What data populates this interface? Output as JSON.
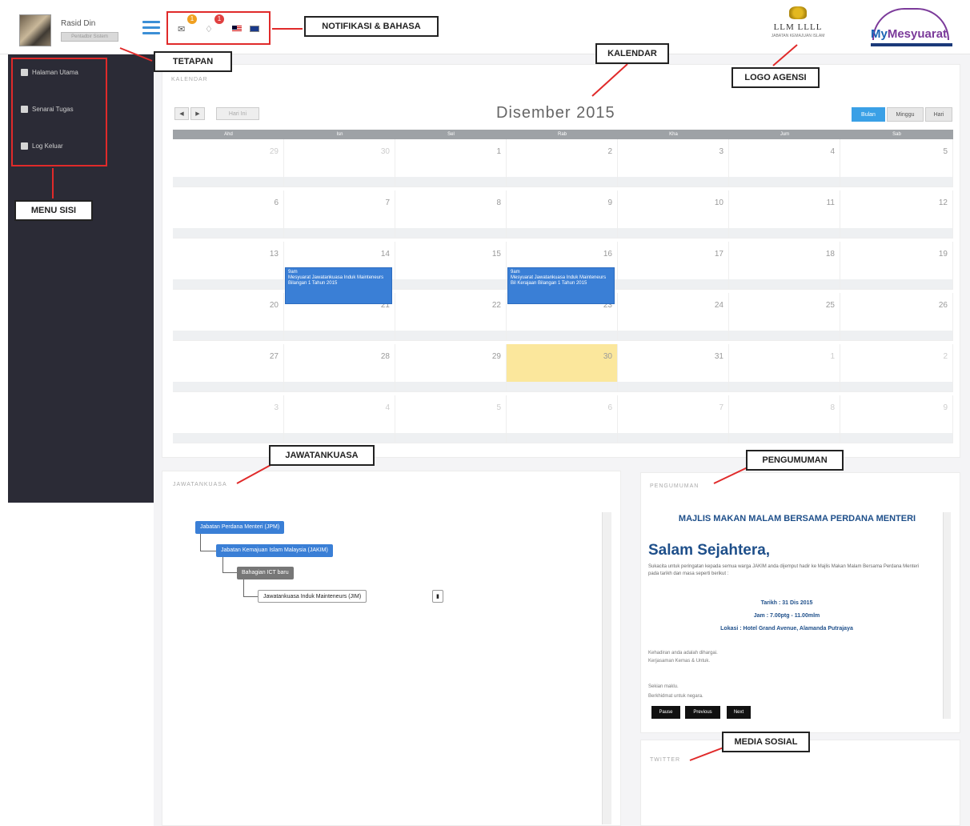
{
  "header": {
    "user_name": "Rasid Din",
    "user_role": "Pentadbir Sistem",
    "menu_icon": "hamburger-icon",
    "notif_count_mail": "1",
    "notif_count_bell": "1",
    "icons": [
      "mail-icon",
      "bell-icon",
      "flag-malaysia-icon",
      "flag-english-icon"
    ]
  },
  "sidebar": {
    "items": [
      {
        "label": "Halaman Utama",
        "icon": "home-icon"
      },
      {
        "label": "Senarai Tugas",
        "icon": "lock-icon"
      },
      {
        "label": "Log Keluar",
        "icon": "lock-icon"
      }
    ]
  },
  "calendar": {
    "panel_title": "KALENDAR",
    "today_button": "Hari Ini",
    "month_title": "Disember 2015",
    "views": [
      "Bulan",
      "Minggu",
      "Hari"
    ],
    "active_view": "Bulan",
    "day_headers": [
      "Ahd",
      "Isn",
      "Sel",
      "Rab",
      "Kha",
      "Jum",
      "Sab"
    ],
    "weeks": [
      [
        "29",
        "30",
        "1",
        "2",
        "3",
        "4",
        "5"
      ],
      [
        "6",
        "7",
        "8",
        "9",
        "10",
        "11",
        "12"
      ],
      [
        "13",
        "14",
        "15",
        "16",
        "17",
        "18",
        "19"
      ],
      [
        "20",
        "21",
        "22",
        "23",
        "24",
        "25",
        "26"
      ],
      [
        "27",
        "28",
        "29",
        "30",
        "31",
        "1",
        "2"
      ],
      [
        "3",
        "4",
        "5",
        "6",
        "7",
        "8",
        "9"
      ]
    ],
    "events": [
      {
        "time": "9am",
        "title": "Mesyuarat Jawatankuasa Induk Mainteneurs Bilangan 1 Tahun 2015"
      },
      {
        "time": "9am",
        "title": "Mesyuarat Jawatankuasa Induk Mainteneurs Bil Kerajaan Bilangan 1 Tahun 2015"
      }
    ],
    "accent": "#3a7fd6",
    "today_color": "#fbe79c"
  },
  "committee": {
    "panel_title": "JAWATANKUASA",
    "nodes": [
      {
        "label": "Jabatan Perdana Menteri (JPM)",
        "color": "#3a7fd6"
      },
      {
        "label": "Jabatan Kemajuan Islam Malaysia (JAKIM)",
        "color": "#3a7fd6"
      },
      {
        "label": "Bahagian ICT baru",
        "color": "#777777"
      },
      {
        "label": "Jawatankuasa Induk Mainteneurs (JIM)",
        "color": "#ffffff"
      }
    ]
  },
  "announcement": {
    "panel_title": "PENGUMUMAN",
    "heading": "MAJLIS MAKAN MALAM BERSAMA PERDANA MENTERI",
    "greeting": "Salam Sejahtera,",
    "body": "Sukacita untuk peringatan kepada semua warga JAKIM anda dijemput hadir ke Majlis Makan Malam Bersama Perdana Menteri pada tarikh dan masa seperti berikut :",
    "date_line": "Tarikh : 31 Dis 2015",
    "time_line": "Jam : 7.00ptg - 11.00mlm",
    "venue_line": "Lokasi : Hotel Grand Avenue, Alamanda Putrajaya",
    "note": "Kehadiran anda adalah dihargai.",
    "note2": "Kerjasaman Kemas & Untuk.",
    "signoff": "Sekian maklu.",
    "signoff2": "Berkhidmat untuk negara.",
    "buttons": [
      "Pause",
      "Previous",
      "Next"
    ]
  },
  "social": {
    "panel_title": "TWITTER"
  },
  "callouts": {
    "notif": "NOTIFIKASI & BAHASA",
    "settings": "TETAPAN",
    "calendar": "KALENDAR",
    "logo": "LOGO AGENSI",
    "side_menu": "MENU SISI",
    "committee": "JAWATANKUASA",
    "announcement": "PENGUMUMAN",
    "social": "MEDIA SOSIAL"
  },
  "logos": {
    "agency_text": "LLM LLLL",
    "agency_sub": "JABATAN KEMAJUAN ISLAM",
    "app_brand_a": "My",
    "app_brand_b": "Mesyuarat"
  },
  "colors": {
    "callout_border": "#e02a2a",
    "sidebar_bg": "#2b2b36",
    "brand_purple": "#7b3a9a",
    "brand_blue": "#1b63b5"
  }
}
